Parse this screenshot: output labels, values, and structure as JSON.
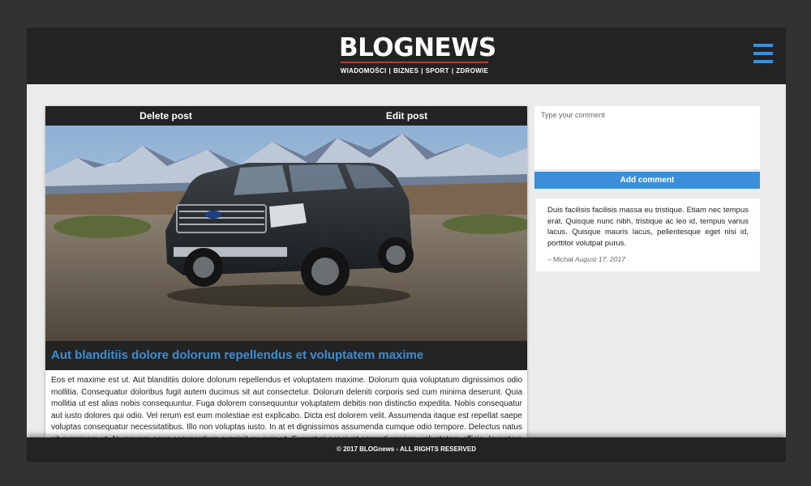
{
  "header": {
    "logo": "BLOGNEWS",
    "nav": [
      "WIADOMOŚCI",
      "BIZNES",
      "SPORT",
      "ZDROWIE"
    ],
    "nav_separator": "|",
    "menu_icon": "hamburger-menu-icon"
  },
  "post": {
    "delete_label": "Delete post",
    "edit_label": "Edit post",
    "title": "Aut blanditiis dolore dolorum repellendus et voluptatem maxime",
    "body": "Eos et maxime est ut. Aut blanditiis dolore dolorum repellendus et voluptatem maxime. Dolorum quia voluptatum dignissimos odio mollitia. Consequatur doloribus fugit autem ducimus sit aut consectetur. Dolorum deleniti corporis sed cum minima deserunt. Quia mollitia ut est alias nobis consequuntur. Fuga dolorem consequuntur voluptatem debitis non distinctio expedita. Nobis consequatur aut iusto dolores qui odio. Vel rerum est eum molestiae est explicabo. Dicta est dolorem velit. Assumenda itaque est repellat saepe voluptas consequatur necessitatibus. Illo non voluptas iusto. In at et dignissimos assumenda cumque odio tempore. Delectus natus sit numquam ut. Numquam error accusantium suscipit ex quia ut. Excepturi nesciunt corrupti veniam voluptatem officia. Inventore sint iste. Unde"
  },
  "sidebar": {
    "comment_placeholder": "Type your comment",
    "add_comment_label": "Add comment",
    "comments": [
      {
        "text": "Duis facilisis facilisis massa eu tristique. Etiam nec tempus erat. Quisque nunc nibh, tristique ac leo id, tempus varius lacus. Quisque mauris lacus, pellentesque eget nisi id, porttitor volutpat purus.",
        "author": "– Michał",
        "date": "August 17, 2017"
      }
    ]
  },
  "footer": {
    "copyright": "© 2017 BLOGnews - ALL RIGHTS RESERVED"
  },
  "colors": {
    "accent": "#3a8fd8",
    "dark": "#232323",
    "background": "#ebebeb"
  }
}
